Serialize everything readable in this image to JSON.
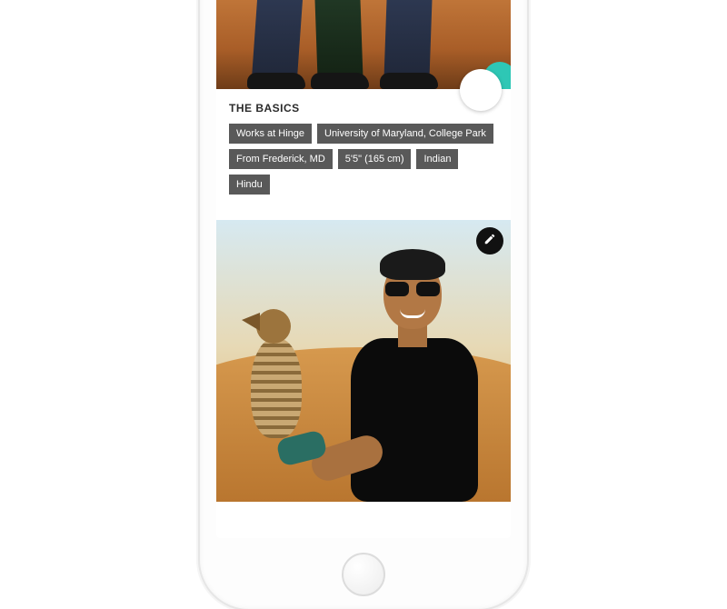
{
  "basics": {
    "title": "THE BASICS",
    "tags": [
      "Works at Hinge",
      "University of Maryland, College Park",
      "From Frederick, MD",
      "5'5\" (165 cm)",
      "Indian",
      "Hindu"
    ]
  }
}
